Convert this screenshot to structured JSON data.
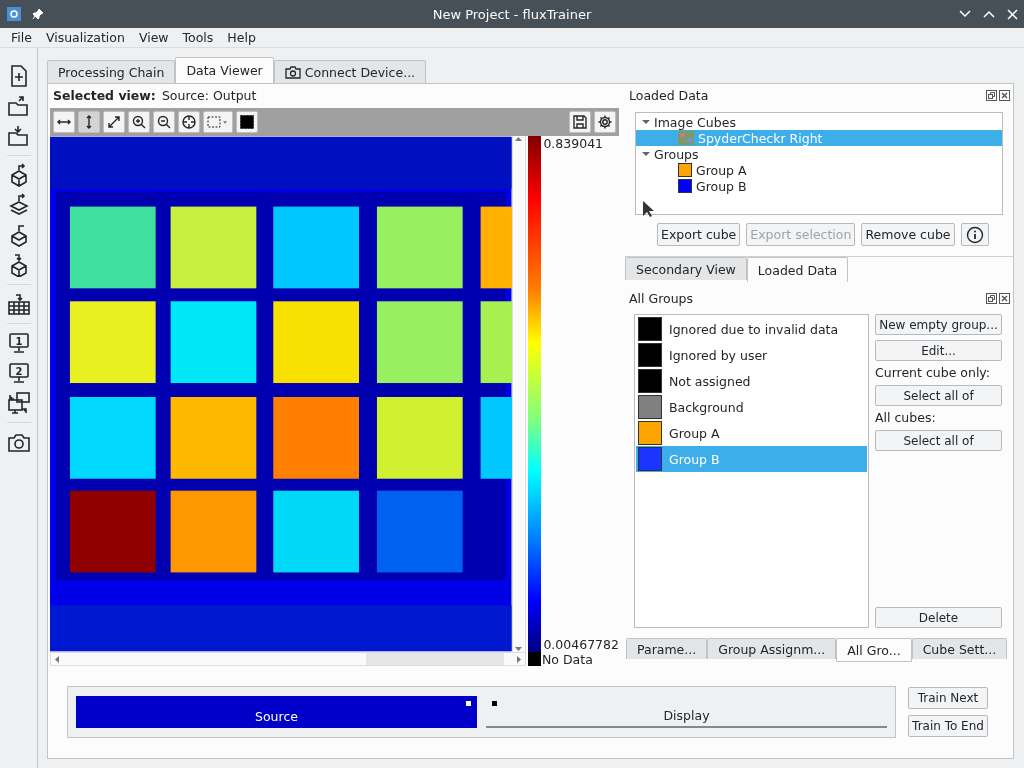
{
  "window": {
    "title": "New Project - fluxTrainer"
  },
  "menu": [
    "File",
    "Visualization",
    "View",
    "Tools",
    "Help"
  ],
  "side_toolbar": [
    {
      "kind": "new-file"
    },
    {
      "kind": "folder-out"
    },
    {
      "kind": "folder-in"
    },
    {
      "kind": "separator"
    },
    {
      "kind": "cube-out"
    },
    {
      "kind": "layers-out"
    },
    {
      "kind": "cubes-out"
    },
    {
      "kind": "cube-in"
    },
    {
      "kind": "separator"
    },
    {
      "kind": "table-in"
    },
    {
      "kind": "separator"
    },
    {
      "kind": "monitor",
      "label": "1"
    },
    {
      "kind": "monitor",
      "label": "2"
    },
    {
      "kind": "monitors"
    },
    {
      "kind": "separator"
    },
    {
      "kind": "camera"
    }
  ],
  "tabs": [
    {
      "label": "Processing Chain",
      "selected": false,
      "kind": "plain"
    },
    {
      "label": "Data Viewer",
      "selected": true,
      "kind": "plain"
    },
    {
      "label": "Connect Device...",
      "selected": false,
      "kind": "camera"
    }
  ],
  "viewer": {
    "selected_view_label": "Selected view:",
    "selected_view": "Source: Output",
    "tools": [
      {
        "kind": "fit-width",
        "selected": false
      },
      {
        "kind": "fit-height",
        "selected": true
      },
      {
        "kind": "fit-all",
        "selected": false
      },
      {
        "kind": "zoom-in",
        "selected": false
      },
      {
        "kind": "zoom-out",
        "selected": false
      },
      {
        "kind": "crosshair",
        "selected": false
      },
      {
        "kind": "select-rect",
        "selected": false
      },
      {
        "kind": "mask",
        "selected": false
      }
    ],
    "colorbar": {
      "max": "0.839041",
      "min": "0.00467782",
      "no_data": "No Data"
    }
  },
  "loaded_data": {
    "title": "Loaded Data",
    "tree": [
      {
        "label": "Image Cubes",
        "expanded": true,
        "selected": false,
        "children": [
          {
            "label": "SpyderCheckr Right",
            "kind": "cube",
            "selected": true
          }
        ]
      },
      {
        "label": "Groups",
        "expanded": true,
        "selected": false,
        "children": [
          {
            "label": "Group A",
            "kind": "group",
            "color": "#ffa500",
            "selected": false
          },
          {
            "label": "Group B",
            "kind": "group",
            "color": "#0000ff",
            "selected": false
          }
        ]
      }
    ],
    "buttons": [
      {
        "label": "Export cube",
        "disabled": false
      },
      {
        "label": "Export selection",
        "disabled": true
      },
      {
        "label": "Remove cube",
        "disabled": false
      }
    ]
  },
  "dock_tabs": [
    {
      "label": "Secondary View",
      "selected": false
    },
    {
      "label": "Loaded Data",
      "selected": true
    }
  ],
  "all_groups": {
    "title": "All Groups",
    "groups": [
      {
        "label": "Ignored due to invalid data",
        "color": "#000000",
        "selected": false
      },
      {
        "label": "Ignored by user",
        "color": "#000000",
        "selected": false
      },
      {
        "label": "Not assigned",
        "color": "#000000",
        "selected": false
      },
      {
        "label": "Background",
        "color": "#808080",
        "selected": false
      },
      {
        "label": "Group A",
        "color": "#ffa500",
        "selected": false
      },
      {
        "label": "Group B",
        "color": "#1a35ff",
        "selected": true
      }
    ],
    "actions": [
      {
        "kind": "button",
        "label": "New empty group..."
      },
      {
        "kind": "button",
        "label": "Edit..."
      },
      {
        "kind": "label",
        "label": "Current cube only:"
      },
      {
        "kind": "button",
        "label": "Select all of"
      },
      {
        "kind": "label",
        "label": "All cubes:"
      },
      {
        "kind": "button",
        "label": "Select all of"
      }
    ],
    "delete_button": "Delete"
  },
  "bottom_tabs": [
    {
      "label": "Parame...",
      "selected": false
    },
    {
      "label": "Group Assignm...",
      "selected": false
    },
    {
      "label": "All Gro...",
      "selected": true
    },
    {
      "label": "Cube Sett...",
      "selected": false
    }
  ],
  "pipeline": [
    {
      "label": "Source",
      "selected": true
    },
    {
      "label": "Display",
      "selected": false
    }
  ],
  "train_buttons": [
    "Train Next",
    "Train To End"
  ]
}
